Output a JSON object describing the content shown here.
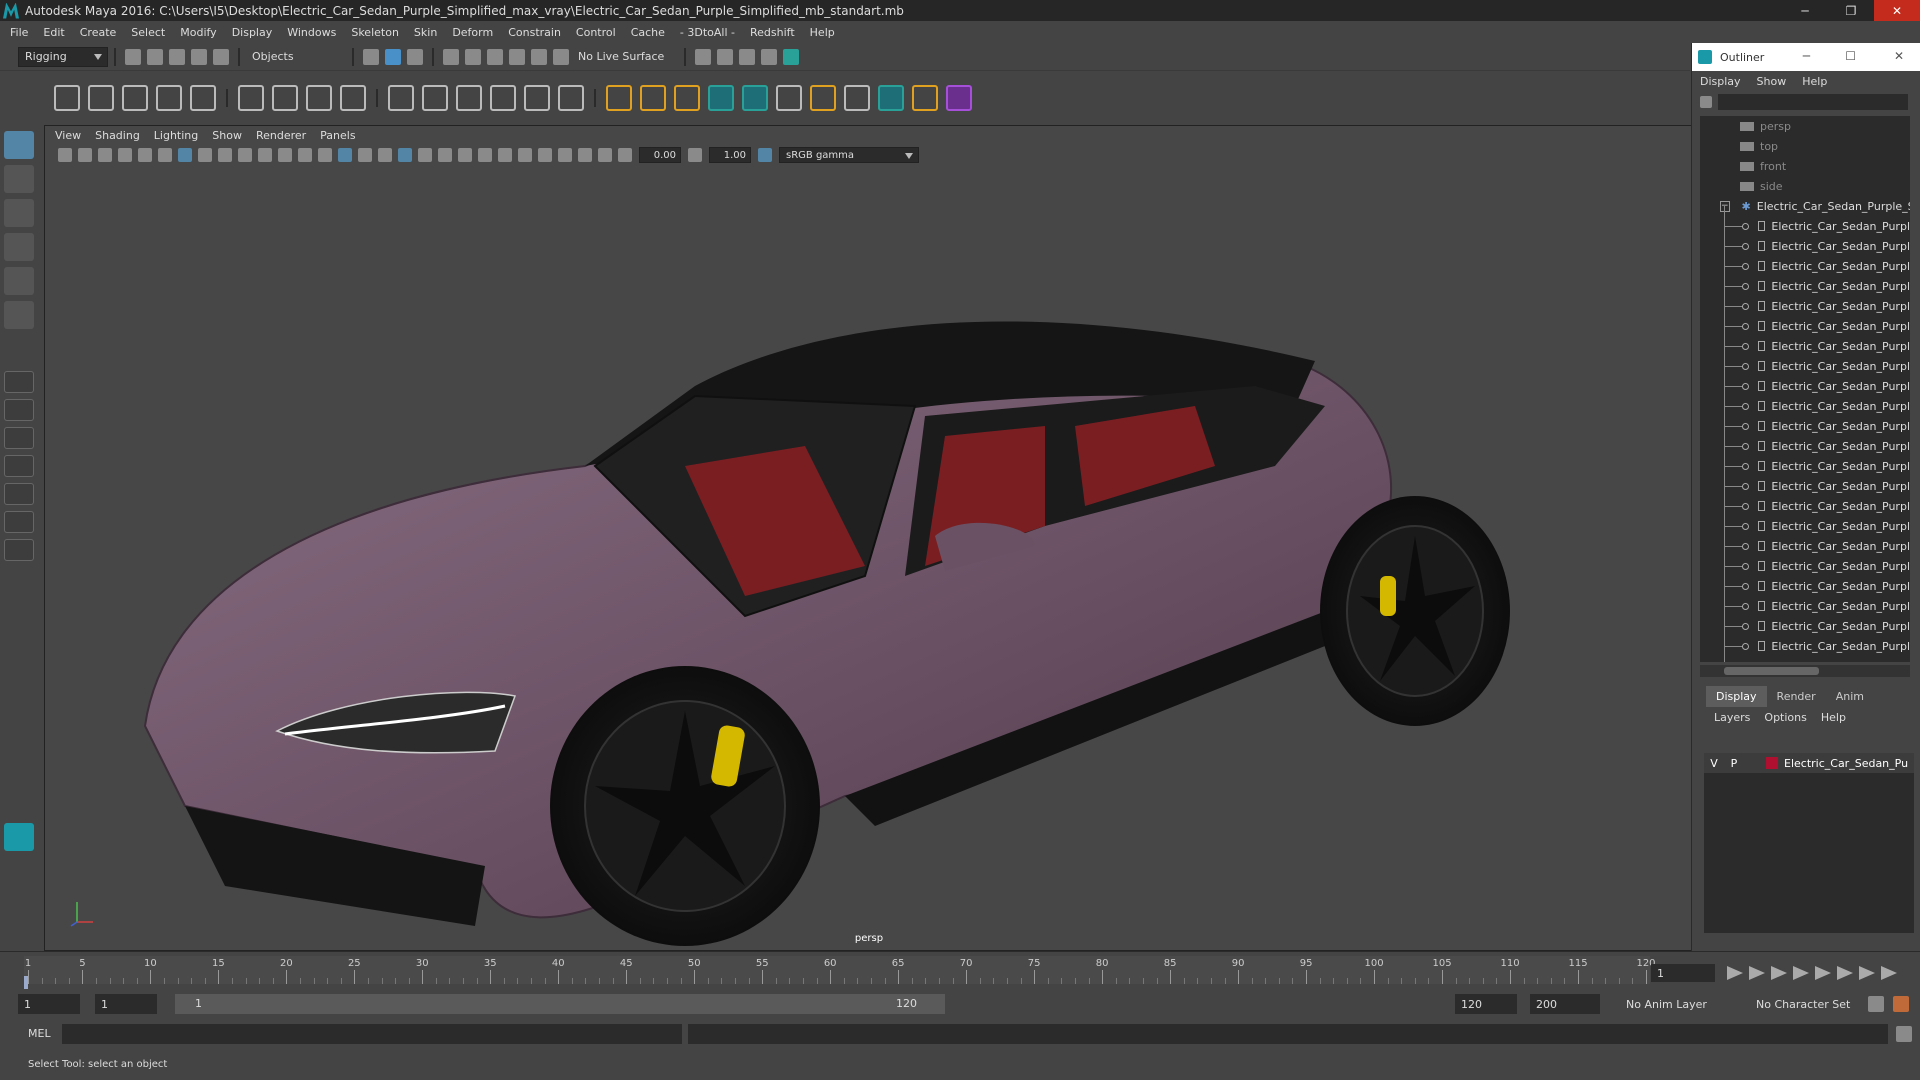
{
  "window": {
    "title": "Autodesk Maya 2016: C:\\Users\\I5\\Desktop\\Electric_Car_Sedan_Purple_Simplified_max_vray\\Electric_Car_Sedan_Purple_Simplified_mb_standart.mb",
    "minimize": "─",
    "maximize": "❐",
    "close": "✕"
  },
  "menu": [
    "File",
    "Edit",
    "Create",
    "Select",
    "Modify",
    "Display",
    "Windows",
    "Skeleton",
    "Skin",
    "Deform",
    "Constrain",
    "Control",
    "Cache",
    "- 3DtoAll -",
    "Redshift",
    "Help"
  ],
  "status": {
    "menuset": "Rigging",
    "selection_mode": "Objects",
    "live_surface": "No Live Surface"
  },
  "viewport": {
    "menu": [
      "View",
      "Shading",
      "Lighting",
      "Show",
      "Renderer",
      "Panels"
    ],
    "exposure": "0.00",
    "gamma_value": "1.00",
    "color_space": "sRGB gamma",
    "camera": "persp"
  },
  "outliner": {
    "title": "Outliner",
    "menu": [
      "Display",
      "Show",
      "Help"
    ],
    "cameras": [
      "persp",
      "top",
      "front",
      "side"
    ],
    "group": "Electric_Car_Sedan_Purple_Si",
    "meshes": [
      "Electric_Car_Sedan_Purpl",
      "Electric_Car_Sedan_Purpl",
      "Electric_Car_Sedan_Purpl",
      "Electric_Car_Sedan_Purpl",
      "Electric_Car_Sedan_Purpl",
      "Electric_Car_Sedan_Purpl",
      "Electric_Car_Sedan_Purpl",
      "Electric_Car_Sedan_Purpl",
      "Electric_Car_Sedan_Purpl",
      "Electric_Car_Sedan_Purpl",
      "Electric_Car_Sedan_Purpl",
      "Electric_Car_Sedan_Purpl",
      "Electric_Car_Sedan_Purpl",
      "Electric_Car_Sedan_Purpl",
      "Electric_Car_Sedan_Purpl",
      "Electric_Car_Sedan_Purpl",
      "Electric_Car_Sedan_Purpl",
      "Electric_Car_Sedan_Purpl",
      "Electric_Car_Sedan_Purpl",
      "Electric_Car_Sedan_Purpl",
      "Electric_Car_Sedan_Purpl",
      "Electric_Car_Sedan_Purpl"
    ]
  },
  "layers": {
    "tabs": [
      "Display",
      "Render",
      "Anim"
    ],
    "menu": [
      "Layers",
      "Options",
      "Help"
    ],
    "row": {
      "v": "V",
      "p": "P",
      "name": "Electric_Car_Sedan_Pu",
      "color": "#b01030"
    }
  },
  "timeline": {
    "labels": [
      "1",
      "5",
      "10",
      "15",
      "20",
      "25",
      "30",
      "35",
      "40",
      "45",
      "50",
      "55",
      "60",
      "65",
      "70",
      "75",
      "80",
      "85",
      "90",
      "95",
      "100",
      "105",
      "110",
      "115",
      "120"
    ],
    "current_frame": "1"
  },
  "range": {
    "start": "1",
    "playback_start": "1",
    "slider_start": "1",
    "slider_end": "120",
    "playback_end": "120",
    "end": "200",
    "anim_layer": "No Anim Layer",
    "character_set": "No Character Set"
  },
  "command": {
    "label": "MEL"
  },
  "help": {
    "text": "Select Tool: select an object"
  },
  "colors": {
    "car_body": "#6e5467",
    "interior": "#7a1e22",
    "caliper": "#d4b800"
  }
}
